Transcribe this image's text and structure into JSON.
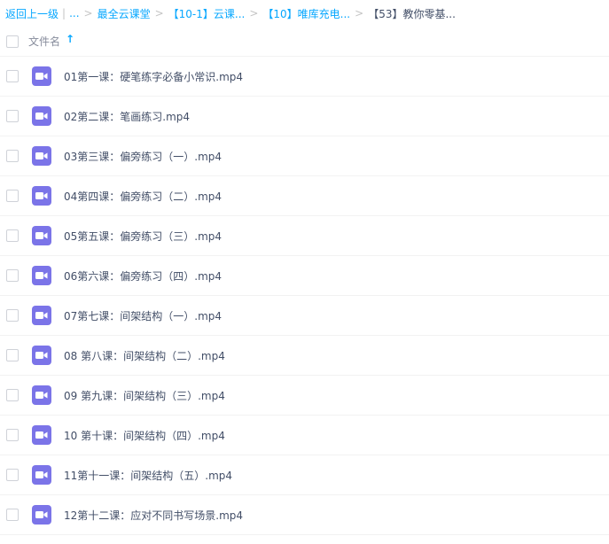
{
  "breadcrumb": {
    "back": "返回上一级",
    "ellipsis": "...",
    "items": [
      "最全云课堂",
      "【10-1】云课...",
      "【10】唯库充电..."
    ],
    "current": "【53】教你零基..."
  },
  "list_header": {
    "name_column": "文件名",
    "sort_icon": "arrow-up-icon",
    "accent_color": "#06a7ff"
  },
  "file_icon": {
    "name": "video-file-icon",
    "color": "#7b74e8"
  },
  "files": [
    {
      "name": "01第一课：硬笔练字必备小常识.mp4"
    },
    {
      "name": "02第二课：笔画练习.mp4"
    },
    {
      "name": "03第三课：偏旁练习（一）.mp4"
    },
    {
      "name": "04第四课：偏旁练习（二）.mp4"
    },
    {
      "name": "05第五课：偏旁练习（三）.mp4"
    },
    {
      "name": "06第六课：偏旁练习（四）.mp4"
    },
    {
      "name": "07第七课：间架结构（一）.mp4"
    },
    {
      "name": "08 第八课：间架结构（二）.mp4"
    },
    {
      "name": "09 第九课：间架结构（三）.mp4"
    },
    {
      "name": "10 第十课：间架结构（四）.mp4"
    },
    {
      "name": "11第十一课：间架结构（五）.mp4"
    },
    {
      "name": "12第十二课：应对不同书写场景.mp4"
    }
  ]
}
